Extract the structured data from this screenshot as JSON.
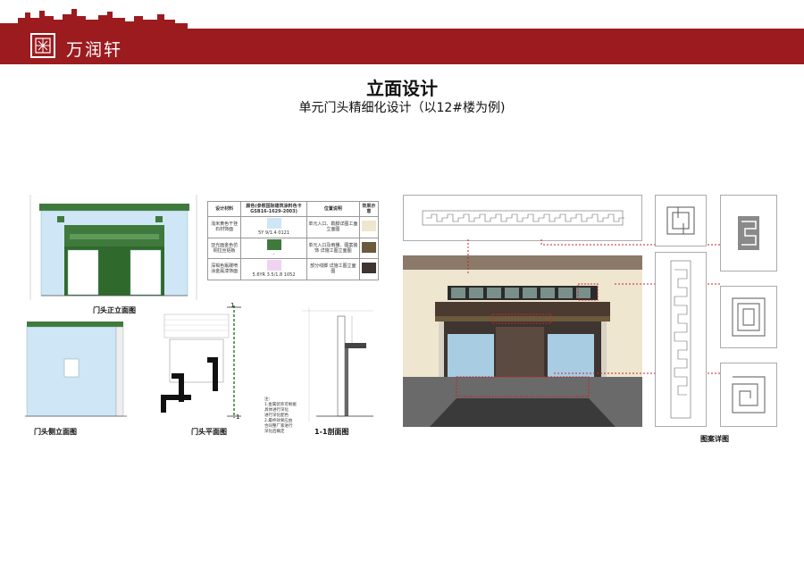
{
  "header": {
    "brand": "万润轩",
    "colors": {
      "banner": "#9b1b1f"
    }
  },
  "page": {
    "title": "立面设计",
    "subtitle": "单元门头精细化设计（以12#楼为例)"
  },
  "captions": {
    "front_elevation": "门头正立面图",
    "side_elevation": "门头侧立面图",
    "plan": "门头平面图",
    "section": "1-1剖面图",
    "pattern_detail": "图案详图"
  },
  "section_mark": "1",
  "material_table": {
    "headers": [
      "设计材料",
      "颜色(参照国际建筑涂料色卡GSB16-1629-2003)",
      "位置说明",
      "效果示意"
    ],
    "rows": [
      {
        "material": "浅米黄色干挂石材饰面",
        "color": "5Y 9/1.4 0121",
        "location": "单元入口、勒脚详图工面立面图",
        "swatch": "#efe6cf"
      },
      {
        "material": "亚光面金色仿铜拉丝铝板",
        "color": "-",
        "location": "单元入口及雨棚、图案装饰 详施工图立面图",
        "swatch": "#6b5a3e"
      },
      {
        "material": "深褐色氟碳喷涂金属漆饰面",
        "color": "5.6YR 3.5/1.8 1052",
        "location": "部分线脚 详施工图立面图",
        "swatch": "#3e3430"
      }
    ],
    "color_swatches": [
      "#cfe6f7",
      "#3f7a3c",
      "#f0d3f2"
    ]
  },
  "notes": [
    "注：",
    "1.金属装饰可根据具体进行深化",
    "进行深化配色",
    "2.最终效果应由",
    "合同整厂家进行",
    "深化后确定"
  ]
}
